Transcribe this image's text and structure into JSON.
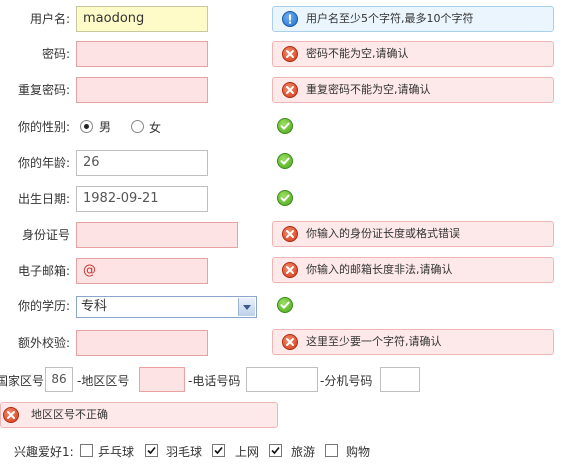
{
  "form": {
    "username": {
      "label": "用户名:",
      "value": "maodong",
      "tip": "用户名至少5个字符,最多10个字符"
    },
    "password": {
      "label": "密码:",
      "value": "",
      "tip": "密码不能为空,请确认"
    },
    "repeat_password": {
      "label": "重复密码:",
      "value": "",
      "tip": "重复密码不能为空,请确认"
    },
    "gender": {
      "label": "你的性别:",
      "options": [
        "男",
        "女"
      ],
      "selected": "男"
    },
    "age": {
      "label": "你的年龄:",
      "value": "26"
    },
    "birthday": {
      "label": "出生日期:",
      "value": "1982-09-21"
    },
    "id_card": {
      "label": "身份证号",
      "value": "",
      "tip": "你输入的身份证长度或格式错误"
    },
    "email": {
      "label": "电子邮箱:",
      "value": "@",
      "tip": "你输入的邮箱长度非法,请确认"
    },
    "education": {
      "label": "你的学历:",
      "selected": "专科"
    },
    "extra": {
      "label": "额外校验:",
      "value": "",
      "tip": "这里至少要一个字符,请确认"
    },
    "phone": {
      "country_label": "国家区号",
      "country_value": "86",
      "area_label": "-地区区号",
      "area_value": "",
      "number_label": "-电话号码",
      "number_value": "",
      "ext_label": "-分机号码",
      "ext_value": "",
      "tip": "地区区号不正确"
    },
    "hobbies": {
      "label": "兴趣爱好1:",
      "items": [
        {
          "label": "乒乓球",
          "checked": false
        },
        {
          "label": "羽毛球",
          "checked": true
        },
        {
          "label": "上网",
          "checked": true
        },
        {
          "label": "旅游",
          "checked": true
        },
        {
          "label": "购物",
          "checked": false
        }
      ]
    }
  },
  "colors": {
    "error_bg": "#fde3e3",
    "focus_bg": "#fffbc8",
    "info_tip_bg": "#eaf5fd",
    "error_tip_bg": "#fde9e9",
    "ok_icon": "#4aa61e",
    "error_icon": "#d63a1a",
    "info_icon": "#1e6fd0"
  },
  "icons": {
    "info": "info-icon",
    "error": "error-icon",
    "ok": "checkmark-icon"
  }
}
